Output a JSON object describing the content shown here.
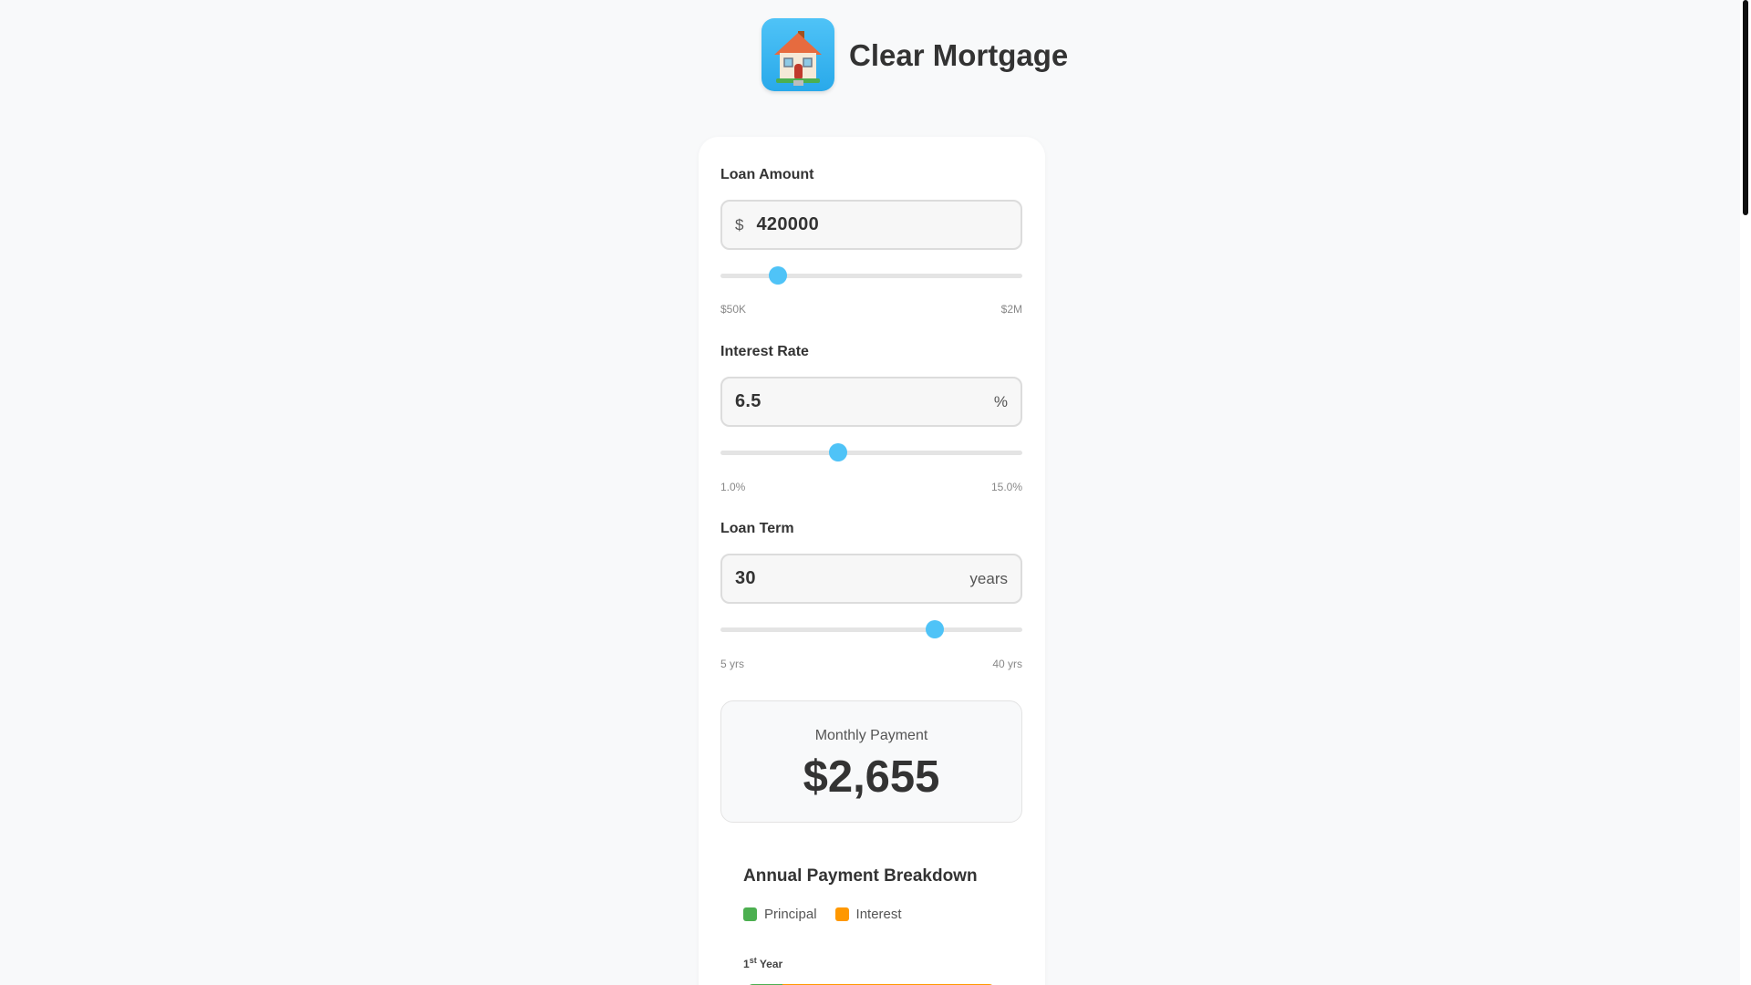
{
  "app": {
    "title": "Clear Mortgage",
    "logo_icon": "house-icon"
  },
  "loan_amount": {
    "label": "Loan Amount",
    "prefix": "$",
    "value": "420000",
    "range_min": "$50K",
    "range_max": "$2M",
    "slider_fraction": 0.19
  },
  "interest_rate": {
    "label": "Interest Rate",
    "value": "6.5",
    "suffix": "%",
    "range_min": "1.0%",
    "range_max": "15.0%",
    "slider_fraction": 0.39
  },
  "loan_term": {
    "label": "Loan Term",
    "value": "30",
    "suffix": "years",
    "range_min": "5 yrs",
    "range_max": "40 yrs",
    "slider_fraction": 0.71
  },
  "result": {
    "label": "Monthly Payment",
    "amount": "$2,655"
  },
  "breakdown": {
    "title": "Annual Payment Breakdown",
    "legend": [
      {
        "label": "Principal",
        "color": "#4caf50"
      },
      {
        "label": "Interest",
        "color": "#ff9800"
      }
    ],
    "year_number": "1",
    "year_suffix": "st",
    "year_word": "Year",
    "principal_share": 0.14
  },
  "colors": {
    "accent": "#4fc3f7",
    "principal": "#4caf50",
    "interest": "#ff9800"
  }
}
